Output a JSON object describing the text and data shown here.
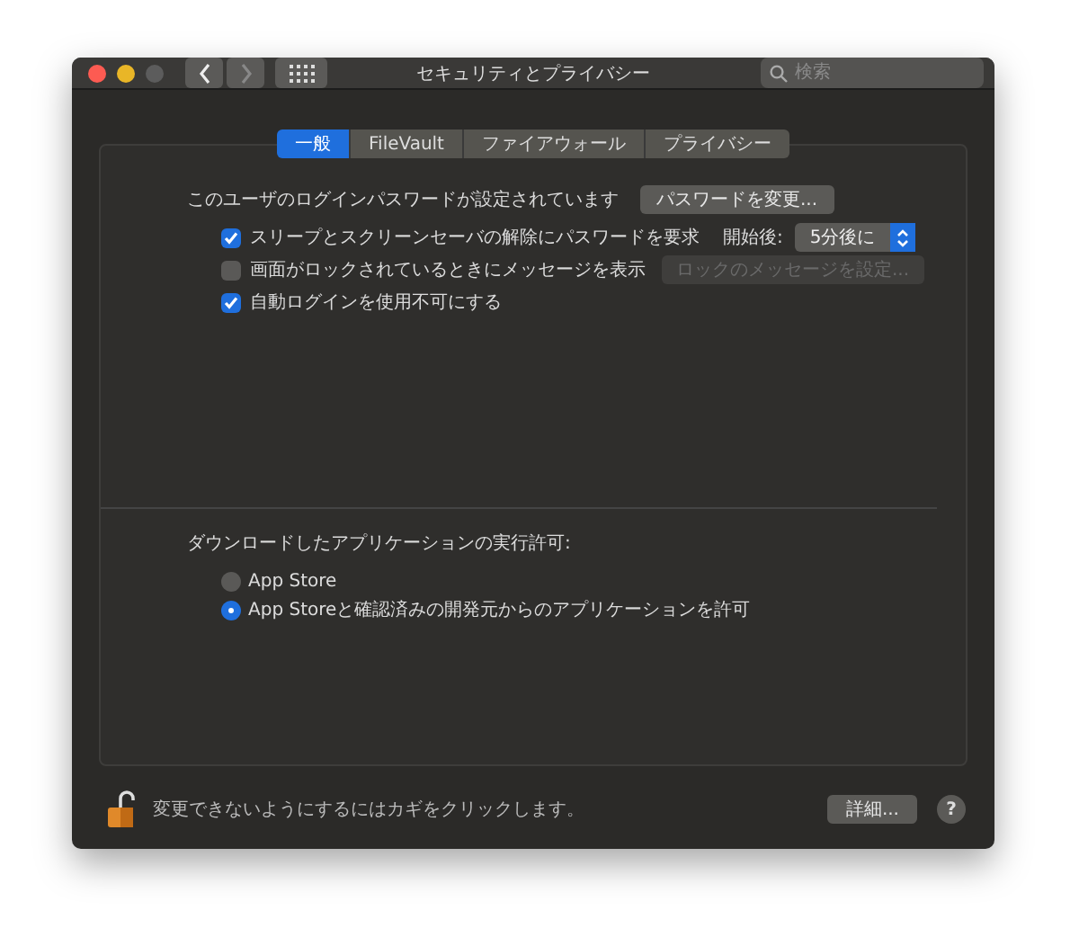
{
  "window": {
    "title": "セキュリティとプライバシー",
    "traffic_lights": [
      {
        "kind": "close",
        "disabled": false
      },
      {
        "kind": "minimize",
        "disabled": false
      },
      {
        "kind": "zoom",
        "disabled": true
      }
    ],
    "back_disabled": false,
    "forward_disabled": true
  },
  "search": {
    "placeholder": "検索"
  },
  "tabs": [
    {
      "label": "一般",
      "selected": true
    },
    {
      "label": "FileVault",
      "selected": false
    },
    {
      "label": "ファイアウォール",
      "selected": false
    },
    {
      "label": "プライバシー",
      "selected": false
    }
  ],
  "password": {
    "label": "このユーザのログインパスワードが設定されています",
    "button": "パスワードを変更..."
  },
  "options": [
    {
      "label": "スリープとスクリーンセーバの解除にパスワードを要求",
      "checked": true,
      "kind": "select",
      "extra_label": "開始後:",
      "value": "5分後に"
    },
    {
      "label": "画面がロックされているときにメッセージを表示",
      "checked": false,
      "kind": "button",
      "button": "ロックのメッセージを設定...",
      "button_disabled": true
    },
    {
      "label": "自動ログインを使用不可にする",
      "checked": true,
      "kind": "plain"
    }
  ],
  "downloads": {
    "label": "ダウンロードしたアプリケーションの実行許可:",
    "options": [
      {
        "label": "App Store",
        "selected": false
      },
      {
        "label": "App Storeと確認済みの開発元からのアプリケーションを許可",
        "selected": true
      }
    ]
  },
  "footer": {
    "locked": false,
    "text": "変更できないようにするにはカギをクリックします。",
    "button": "詳細...",
    "help": "?"
  }
}
